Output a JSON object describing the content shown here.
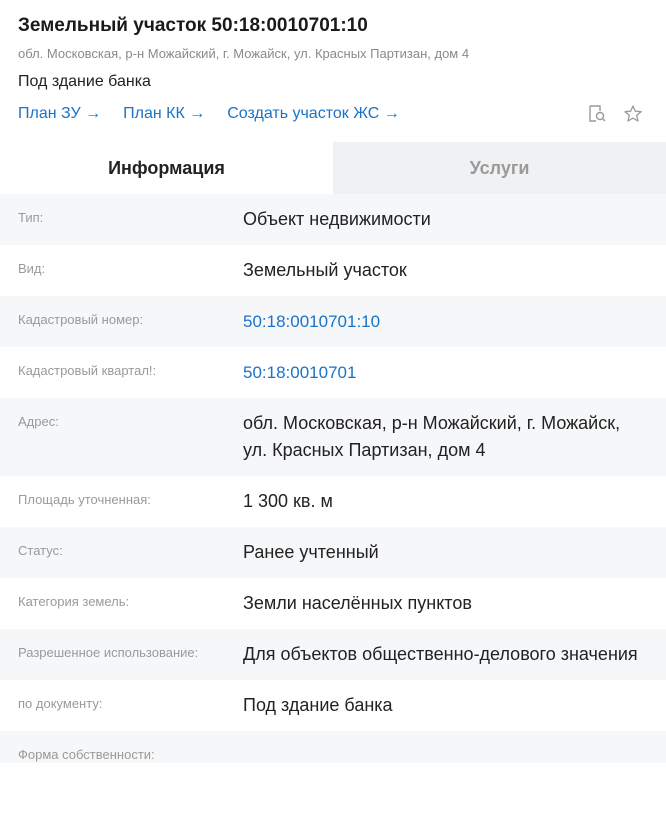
{
  "header": {
    "title": "Земельный участок 50:18:0010701:10",
    "address": "обл. Московская, р-н Можайский, г. Можайск, ул. Красных Партизан, дом 4",
    "purpose": "Под здание банка",
    "links": [
      "План ЗУ →",
      "План КК →",
      "Создать участок ЖС →"
    ],
    "icons": [
      "search-document-icon",
      "star-icon"
    ]
  },
  "tabs": [
    {
      "label": "Информация",
      "active": true
    },
    {
      "label": "Услуги",
      "active": false
    }
  ],
  "rows": [
    {
      "label": "Тип:",
      "value": "Объект недвижимости"
    },
    {
      "label": "Вид:",
      "value": "Земельный участок"
    },
    {
      "label": "Кадастровый номер:",
      "value": "50:18:0010701:10"
    },
    {
      "label": "Кадастровый квартал!:",
      "value": "50:18:0010701"
    },
    {
      "label": "Адрес:",
      "value": "обл. Московская, р-н Можайский, г. Можайск, ул. Красных Партизан, дом 4"
    },
    {
      "label": "Площадь уточненная:",
      "value": "1 300 кв. м"
    },
    {
      "label": "Статус:",
      "value": "Ранее учтенный"
    },
    {
      "label": "Категория земель:",
      "value": "Земли населённых пунктов"
    },
    {
      "label": "Разрешенное использование:",
      "value": "Для объектов общественно-делового значения"
    },
    {
      "label": "по документу:",
      "value": "Под здание банка"
    },
    {
      "label": "Форма собственности:",
      "value": ""
    }
  ],
  "colors": {
    "link": "#1a73c7",
    "muted": "#9a9a9a",
    "tab_inactive_bg": "#f0f1f3",
    "row_alt_bg": "#f6f7f9"
  }
}
